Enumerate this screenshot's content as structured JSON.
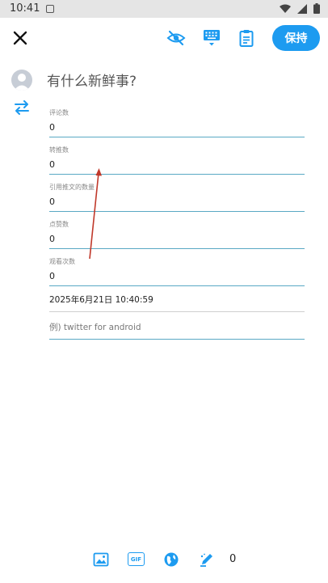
{
  "status_bar": {
    "time": "10:41"
  },
  "toolbar": {
    "save_label": "保持"
  },
  "compose": {
    "placeholder": "有什么新鲜事?"
  },
  "fields": [
    {
      "label": "评论数",
      "value": "0"
    },
    {
      "label": "转推数",
      "value": "0"
    },
    {
      "label": "引用推文的数量",
      "value": "0"
    },
    {
      "label": "点赞数",
      "value": "0"
    },
    {
      "label": "观看次数",
      "value": "0"
    }
  ],
  "date_field": {
    "value": "2025年6月21日 10:40:59"
  },
  "client_field": {
    "placeholder": "例) twitter for android"
  },
  "bottom_bar": {
    "count": "0"
  },
  "colors": {
    "accent": "#1d9bf0",
    "underline": "#5aa9c4",
    "annotation_arrow": "#c0392b"
  }
}
